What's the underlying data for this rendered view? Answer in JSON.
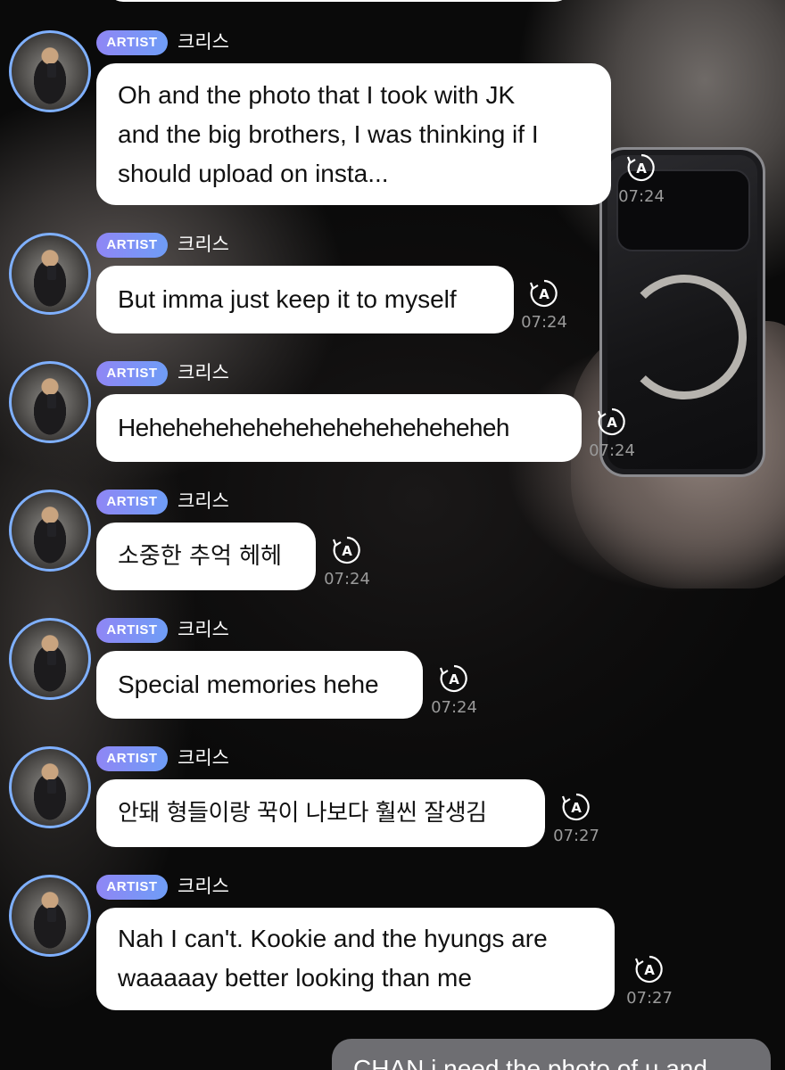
{
  "badge_label": "ARTIST",
  "artist_name": "크리스",
  "colors": {
    "badge_start": "#8f86f5",
    "badge_end": "#6f9df6",
    "avatar_ring": "#7fb0ff",
    "bubble": "#ffffff",
    "fan_bubble": "#6e6e72"
  },
  "messages": [
    {
      "text": "Oh and the photo that I took with JK\nand the big brothers, I was thinking if I\nshould upload on insta...",
      "time": "07:24",
      "icon": "auto-translate-icon"
    },
    {
      "text": "But imma just keep it to myself",
      "time": "07:24",
      "icon": "auto-translate-icon"
    },
    {
      "text": "Heheheheheheheheheheheheheheh",
      "time": "07:24",
      "icon": "auto-translate-icon"
    },
    {
      "text": "소중한 추억 헤헤",
      "time": "07:24",
      "icon": "auto-translate-icon"
    },
    {
      "text": "Special memories hehe",
      "time": "07:24",
      "icon": "auto-translate-icon"
    },
    {
      "text": "안돼 형들이랑 꾹이 나보다 훨씬 잘생김",
      "time": "07:27",
      "icon": "auto-translate-icon"
    },
    {
      "text": "Nah I can't. Kookie and the hyungs are\nwaaaaay better looking than me",
      "time": "07:27",
      "icon": "auto-translate-icon"
    }
  ],
  "fan_message": "CHAN i need the photo of u and"
}
